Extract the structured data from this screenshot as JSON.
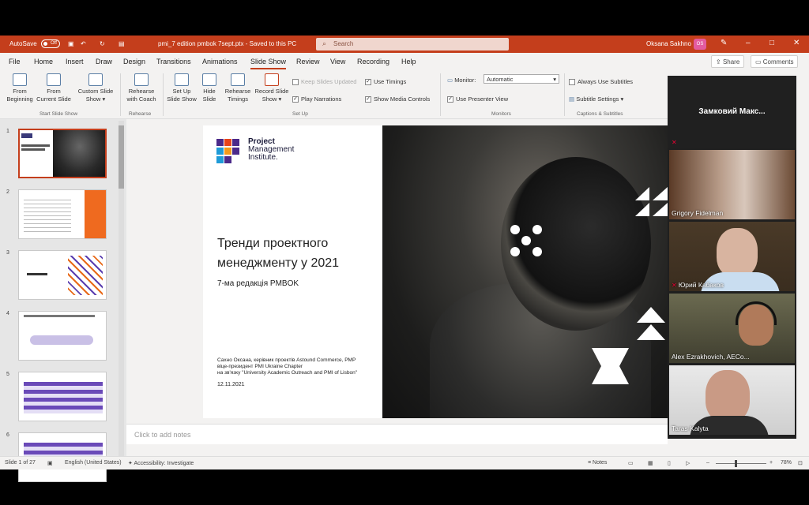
{
  "titlebar": {
    "autosave": "AutoSave",
    "autosave_state": "Off",
    "filename": "pmi_7 edition pmbok 7sept.ptx  -  Saved to this PC",
    "search": "Search",
    "user": "Oksana Sakhno",
    "initials": "OS"
  },
  "menu": [
    "File",
    "Home",
    "Insert",
    "Draw",
    "Design",
    "Transitions",
    "Animations",
    "Slide Show",
    "Review",
    "View",
    "Recording",
    "Help"
  ],
  "share": "Share",
  "comments": "Comments",
  "ribbon": {
    "from_beginning": [
      "From",
      "Beginning"
    ],
    "from_current": [
      "From",
      "Current Slide"
    ],
    "custom": [
      "Custom Slide",
      "Show"
    ],
    "rehearse_coach": [
      "Rehearse",
      "with Coach"
    ],
    "setup": [
      "Set Up",
      "Slide Show"
    ],
    "hide": [
      "Hide",
      "Slide"
    ],
    "timings": [
      "Rehearse",
      "Timings"
    ],
    "record": [
      "Record Slide",
      "Show"
    ],
    "keep_updated": "Keep Slides Updated",
    "use_timings": "Use Timings",
    "play_narrations": "Play Narrations",
    "show_media": "Show Media Controls",
    "monitor_label": "Monitor:",
    "monitor_value": "Automatic",
    "presenter_view": "Use Presenter View",
    "always_subtitles": "Always Use Subtitles",
    "subtitle_settings": "Subtitle Settings",
    "groups": [
      "Start Slide Show",
      "Rehearse",
      "Set Up",
      "Monitors",
      "Captions & Subtitles"
    ]
  },
  "thumbnails": [
    "1",
    "2",
    "3",
    "4",
    "5",
    "6"
  ],
  "slide": {
    "logo": [
      "Project",
      "Management",
      "Institute."
    ],
    "title": [
      "Тренди проектного",
      "менеджменту у 2021"
    ],
    "subtitle": "7-ма редакція PMBOK",
    "footer": [
      "Сахно Оксана, керівник проектів Astound Commerce, PMP",
      "віце-президент PMI Ukraine Chapter",
      "на зв'язку \"University Academic Outreach and PMI of Lisbon\""
    ],
    "date": "12.11.2021"
  },
  "notes_placeholder": "Click to add notes",
  "status": {
    "slide": "Slide 1 of 27",
    "lang": "English (United States)",
    "accessibility": "Accessibility: Investigate",
    "notes": "Notes",
    "zoom": "78%"
  },
  "video": {
    "header": "Замковий  Макс...",
    "participants": [
      "Grigory Fidelman",
      "Юрий Кабаков",
      "Alex Ezrakhovich, AECo...",
      "Taras Kalyta"
    ]
  }
}
